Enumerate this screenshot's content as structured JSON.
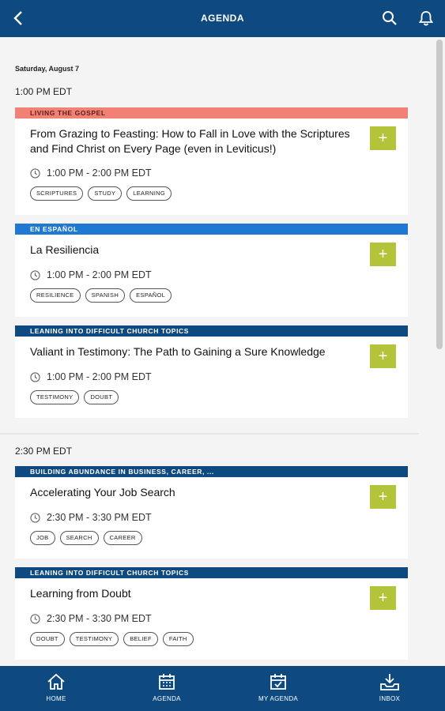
{
  "header": {
    "title": "AGENDA"
  },
  "date": "Saturday, August 7",
  "sections": [
    {
      "time": "1:00 PM EDT",
      "sessions": [
        {
          "category": "LIVING THE GOSPEL",
          "title": "From Grazing to Feasting: How to Fall in Love with the Scriptures and Find Christ on Every Page (even in Leviticus!)",
          "time": "1:00 PM - 2:00 PM EDT",
          "tags": [
            "SCRIPTURES",
            "STUDY",
            "LEARNING"
          ],
          "add": "+"
        },
        {
          "category": "EN ESPAÑOL",
          "title": "La Resiliencia",
          "time": "1:00 PM - 2:00 PM EDT",
          "tags": [
            "RESILIENCE",
            "SPANISH",
            "ESPAÑOL"
          ],
          "add": "+"
        },
        {
          "category": "LEANING INTO DIFFICULT CHURCH TOPICS",
          "title": "Valiant in Testimony: The Path to Gaining a Sure Knowledge",
          "time": "1:00 PM - 2:00 PM EDT",
          "tags": [
            "TESTIMONY",
            "DOUBT"
          ],
          "add": "+"
        }
      ]
    },
    {
      "time": "2:30 PM EDT",
      "sessions": [
        {
          "category": "BUILDING ABUNDANCE IN BUSINESS, CAREER, ...",
          "title": "Accelerating Your Job Search",
          "time": "2:30 PM - 3:30 PM EDT",
          "tags": [
            "JOB",
            "SEARCH",
            "CAREER"
          ],
          "add": "+"
        },
        {
          "category": "LEANING INTO DIFFICULT CHURCH TOPICS",
          "title": "Learning from Doubt",
          "time": "2:30 PM - 3:30 PM EDT",
          "tags": [
            "DOUBT",
            "TESTIMONY",
            "BELIEF",
            "FAITH"
          ],
          "add": "+"
        }
      ]
    }
  ],
  "nav": [
    {
      "label": "HOME",
      "icon": "home-icon"
    },
    {
      "label": "AGENDA",
      "icon": "calendar-icon"
    },
    {
      "label": "MY AGENDA",
      "icon": "calendar-check-icon"
    },
    {
      "label": "INBOX",
      "icon": "inbox-icon"
    }
  ],
  "colors": {
    "header": "#0e4a80",
    "salmon": "#f18174",
    "brightblue": "#1f78d1",
    "navy": "#0e4a80",
    "addButton": "#b3c43a"
  }
}
